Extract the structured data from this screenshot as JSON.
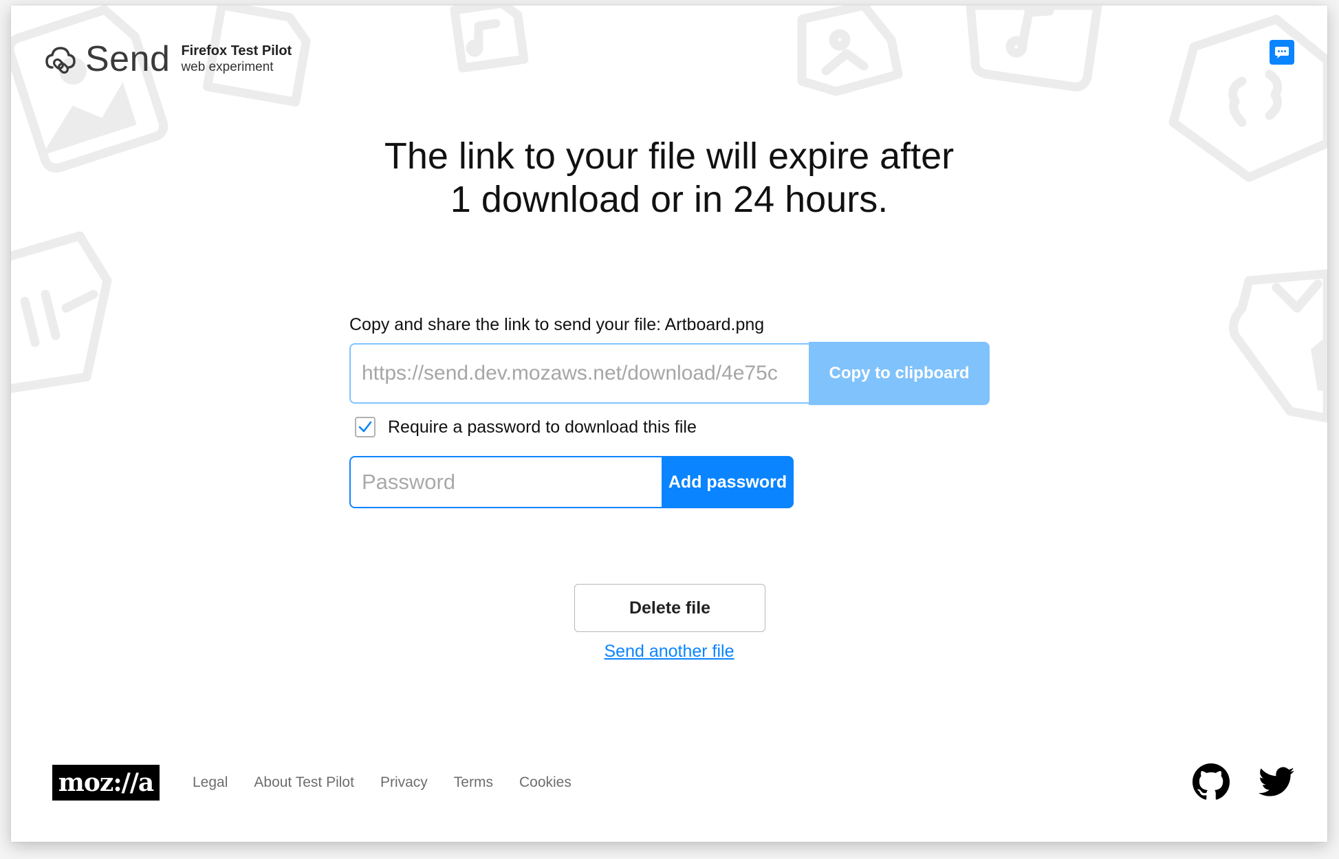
{
  "header": {
    "app_name": "Send",
    "tagline_line1": "Firefox Test Pilot",
    "tagline_line2": "web experiment",
    "logo_icon": "cloud-link-icon",
    "feedback_icon": "chat-bubble-icon"
  },
  "main": {
    "title_line1": "The link to your file will expire after",
    "title_line2": "1 download or in 24 hours.",
    "share_label": "Copy and share the link to send your file: Artboard.png",
    "link_value": "https://send.dev.mozaws.net/download/4e75c",
    "copy_button": "Copy to clipboard",
    "require_password": {
      "label": "Require a password to download this file",
      "checked": true
    },
    "password_placeholder": "Password",
    "add_password_button": "Add password",
    "delete_button": "Delete file",
    "send_another_link": "Send another file"
  },
  "footer": {
    "logo_text": "moz://a",
    "links": [
      "Legal",
      "About Test Pilot",
      "Privacy",
      "Terms",
      "Cookies"
    ],
    "social_icons": [
      "github-icon",
      "twitter-icon"
    ]
  },
  "colors": {
    "accent": "#0a84ff",
    "accent_disabled": "#80c2fb",
    "text": "#0c0c0d",
    "footer_link": "#6d6d6d"
  }
}
